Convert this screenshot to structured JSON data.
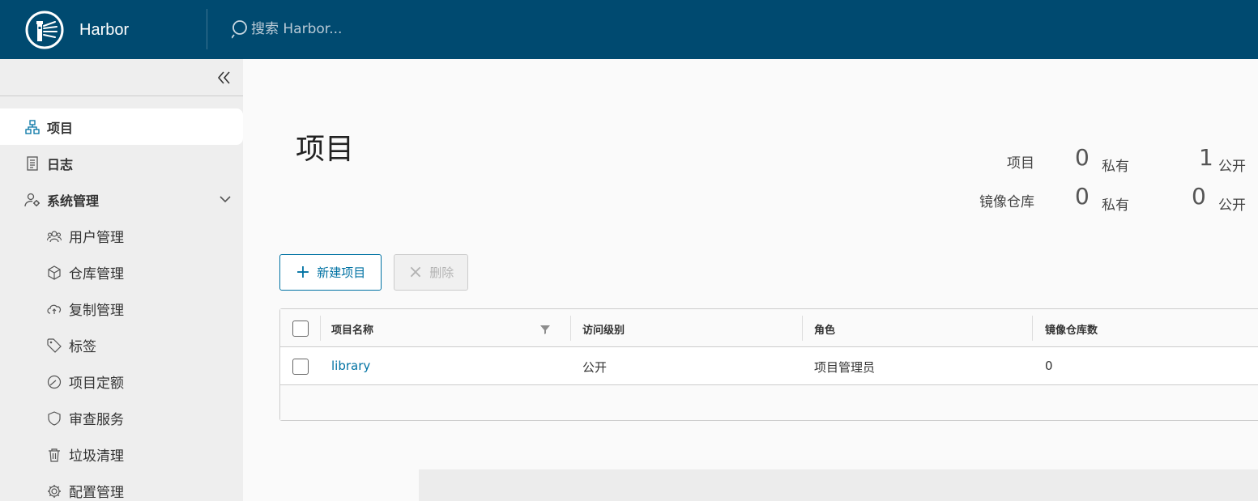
{
  "header": {
    "brand": "Harbor",
    "search_placeholder": "搜索 Harbor..."
  },
  "sidebar": {
    "items": [
      {
        "label": "项目",
        "icon": "project-icon",
        "active": true
      },
      {
        "label": "日志",
        "icon": "log-icon"
      },
      {
        "label": "系统管理",
        "icon": "admin-icon",
        "expanded": true
      }
    ],
    "sub_items": [
      {
        "label": "用户管理",
        "icon": "users-icon"
      },
      {
        "label": "仓库管理",
        "icon": "registry-icon"
      },
      {
        "label": "复制管理",
        "icon": "replication-icon"
      },
      {
        "label": "标签",
        "icon": "tag-icon"
      },
      {
        "label": "项目定额",
        "icon": "quota-icon"
      },
      {
        "label": "审查服务",
        "icon": "shield-icon"
      },
      {
        "label": "垃圾清理",
        "icon": "trash-icon"
      },
      {
        "label": "配置管理",
        "icon": "gear-icon"
      }
    ]
  },
  "main": {
    "title": "项目",
    "summary": {
      "projects_label": "项目",
      "repos_label": "镜像仓库",
      "private_label": "私有",
      "public_label": "公开",
      "projects_private": "0",
      "projects_public": "1",
      "repos_private": "0",
      "repos_public": "0"
    },
    "actions": {
      "new_label": "新建项目",
      "delete_label": "删除"
    },
    "table": {
      "columns": [
        "项目名称",
        "访问级别",
        "角色",
        "镜像仓库数"
      ],
      "rows": [
        {
          "name": "library",
          "access": "公开",
          "role": "项目管理员",
          "repo_count": "0"
        }
      ]
    }
  },
  "colors": {
    "header_bg": "#004a70",
    "accent": "#0072a3",
    "sidebar_bg": "#eeeeee"
  }
}
